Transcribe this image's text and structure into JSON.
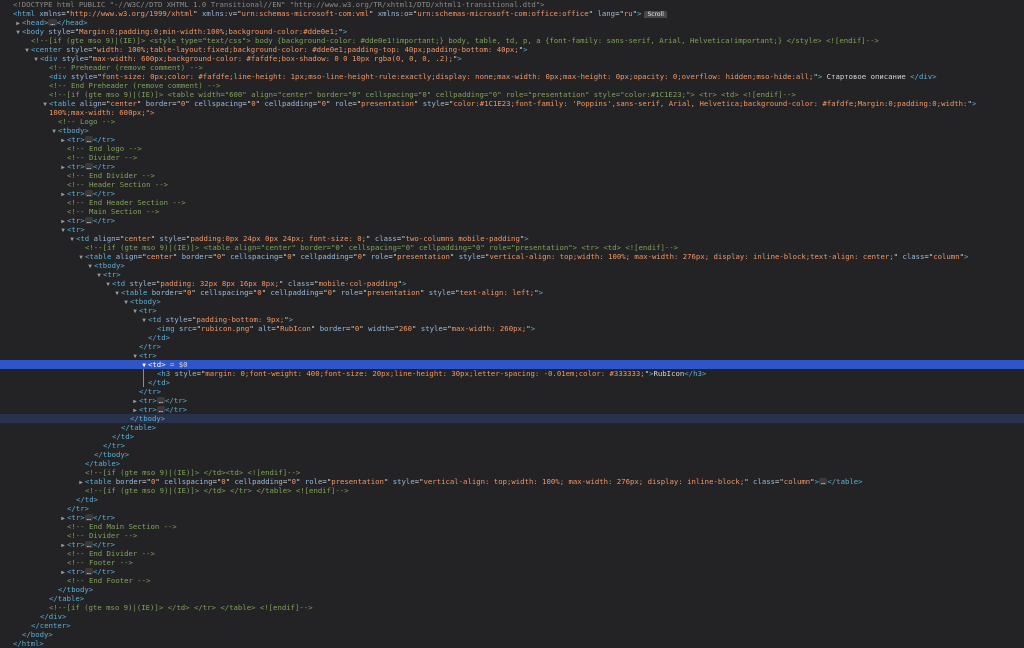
{
  "app": {
    "scroll_badge": "Scroll",
    "selected_suffix": " = $0",
    "ellipsis": "…"
  },
  "rows": [
    {
      "i": 0,
      "k": "doctype",
      "text": "<!DOCTYPE html PUBLIC \"-//W3C//DTD XHTML 1.0 Transitional//EN\" \"http://www.w3.org/TR/xhtml1/DTD/xhtml1-transitional.dtd\">"
    },
    {
      "i": 0,
      "k": "tag",
      "t": "",
      "tag": "html",
      "attrs": [
        [
          "xmlns",
          "http://www.w3.org/1999/xhtml"
        ],
        [
          "xmlns:v",
          "urn:schemas-microsoft-com:vml"
        ],
        [
          "xmlns:o",
          "urn:schemas-microsoft-com:office:office"
        ],
        [
          "lang",
          "ru"
        ]
      ],
      "badge": true
    },
    {
      "i": 1,
      "k": "tag",
      "t": "▶",
      "tag": "head",
      "collapsed": true
    },
    {
      "i": 1,
      "k": "tag",
      "t": "▼",
      "tag": "body",
      "attrs": [
        [
          "style",
          "Margin:0;padding:0;min-width:100%;background-color:#dde0e1;"
        ]
      ]
    },
    {
      "i": 2,
      "k": "comment",
      "text": "<!--[if (gte mso 9)|(IE)]> <style type=\"text/css\"> body {background-color: #dde0e1!important;} body, table, td, p, a {font-family: sans-serif, Arial, Helvetica!important;} </style> <![endif]-->"
    },
    {
      "i": 2,
      "k": "tag",
      "t": "▼",
      "tag": "center",
      "attrs": [
        [
          "style",
          "width: 100%;table-layout:fixed;background-color: #dde0e1;padding-top: 40px;padding-bottom: 40px;"
        ]
      ]
    },
    {
      "i": 3,
      "k": "tag",
      "t": "▼",
      "tag": "div",
      "attrs": [
        [
          "style",
          "max-width: 600px;background-color: #fafdfe;box-shadow: 0 0 10px rgba(0, 0, 0, .2);"
        ]
      ]
    },
    {
      "i": 4,
      "k": "comment",
      "text": "<!-- Preheader (remove comment) -->"
    },
    {
      "i": 4,
      "k": "tagtext",
      "t": "",
      "tag": "div",
      "attrs": [
        [
          "style",
          "font-size: 0px;color: #fafdfe;line-height: 1px;mso-line-height-rule:exactly;display: none;max-width: 0px;max-height: 0px;opacity: 0;overflow: hidden;mso-hide:all;"
        ]
      ],
      "inner": " Стартовое описание "
    },
    {
      "i": 4,
      "k": "comment",
      "text": "<!-- End Preheader (remove comment) -->"
    },
    {
      "i": 4,
      "k": "comment",
      "text": "<!--[if (gte mso 9)|(IE)]> <table width=\"600\" align=\"center\" border=\"0\" cellspacing=\"0\" cellpadding=\"0\" role=\"presentation\" style=\"color:#1C1E23;\"> <tr> <td> <![endif]-->"
    },
    {
      "i": 4,
      "k": "tag",
      "t": "▼",
      "tag": "table",
      "attrs": [
        [
          "align",
          "center"
        ],
        [
          "border",
          "0"
        ],
        [
          "cellspacing",
          "0"
        ],
        [
          "cellpadding",
          "0"
        ],
        [
          "role",
          "presentation"
        ],
        [
          "style",
          "color:#1C1E23;font-family: 'Poppins',sans-serif, Arial, Helvetica;background-color: #fafdfe;Margin:0;padding:0;width:"
        ]
      ]
    },
    {
      "i": 4,
      "k": "cont",
      "text": "100%;max-width: 600px;\">"
    },
    {
      "i": 5,
      "k": "comment",
      "text": "<!-- Logo -->"
    },
    {
      "i": 5,
      "k": "tag",
      "t": "▼",
      "tag": "tbody"
    },
    {
      "i": 6,
      "k": "tag",
      "t": "▶",
      "tag": "tr",
      "collapsed": true
    },
    {
      "i": 6,
      "k": "comment",
      "text": "<!-- End logo -->"
    },
    {
      "i": 6,
      "k": "comment",
      "text": "<!-- Divider -->"
    },
    {
      "i": 6,
      "k": "tag",
      "t": "▶",
      "tag": "tr",
      "collapsed": true
    },
    {
      "i": 6,
      "k": "comment",
      "text": "<!-- End Divider -->"
    },
    {
      "i": 6,
      "k": "comment",
      "text": "<!-- Header Section -->"
    },
    {
      "i": 6,
      "k": "tag",
      "t": "▶",
      "tag": "tr",
      "collapsed": true
    },
    {
      "i": 6,
      "k": "comment",
      "text": "<!-- End Header Section -->"
    },
    {
      "i": 6,
      "k": "comment",
      "text": "<!-- Main Section -->"
    },
    {
      "i": 6,
      "k": "tag",
      "t": "▶",
      "tag": "tr",
      "collapsed": true
    },
    {
      "i": 6,
      "k": "tag",
      "t": "▼",
      "tag": "tr"
    },
    {
      "i": 7,
      "k": "tag",
      "t": "▼",
      "tag": "td",
      "attrs": [
        [
          "align",
          "center"
        ],
        [
          "style",
          "padding:0px 24px 0px 24px; font-size: 0;"
        ],
        [
          "class",
          "two-columns mobile-padding"
        ]
      ]
    },
    {
      "i": 8,
      "k": "comment",
      "text": "<!--[if (gte mso 9)|(IE)]> <table align=\"center\" border=\"0\" cellspacing=\"0\" cellpadding=\"0\" role=\"presentation\"> <tr> <td> <![endif]-->"
    },
    {
      "i": 8,
      "k": "tag",
      "t": "▼",
      "tag": "table",
      "attrs": [
        [
          "align",
          "center"
        ],
        [
          "border",
          "0"
        ],
        [
          "cellspacing",
          "0"
        ],
        [
          "cellpadding",
          "0"
        ],
        [
          "role",
          "presentation"
        ],
        [
          "style",
          "vertical-align: top;width: 100%; max-width: 276px; display: inline-block;text-align: center;"
        ],
        [
          "class",
          "column"
        ]
      ]
    },
    {
      "i": 9,
      "k": "tag",
      "t": "▼",
      "tag": "tbody"
    },
    {
      "i": 10,
      "k": "tag",
      "t": "▼",
      "tag": "tr"
    },
    {
      "i": 11,
      "k": "tag",
      "t": "▼",
      "tag": "td",
      "attrs": [
        [
          "style",
          "padding: 32px 8px 16px 8px;"
        ],
        [
          "class",
          "mobile-col-padding"
        ]
      ]
    },
    {
      "i": 12,
      "k": "tag",
      "t": "▼",
      "tag": "table",
      "attrs": [
        [
          "border",
          "0"
        ],
        [
          "cellspacing",
          "0"
        ],
        [
          "cellpadding",
          "0"
        ],
        [
          "role",
          "presentation"
        ],
        [
          "style",
          "text-align: left;"
        ]
      ]
    },
    {
      "i": 13,
      "k": "tag",
      "t": "▼",
      "tag": "tbody"
    },
    {
      "i": 14,
      "k": "tag",
      "t": "▼",
      "tag": "tr"
    },
    {
      "i": 15,
      "k": "tag",
      "t": "▼",
      "tag": "td",
      "attrs": [
        [
          "style",
          "padding-bottom: 9px;"
        ]
      ]
    },
    {
      "i": 16,
      "k": "tag",
      "t": "",
      "tag": "img",
      "attrs": [
        [
          "src",
          "rubicon.png"
        ],
        [
          "alt",
          "RubIcon"
        ],
        [
          "border",
          "0"
        ],
        [
          "width",
          "260"
        ],
        [
          "style",
          "max-width: 260px;"
        ]
      ],
      "selfclose": true
    },
    {
      "i": 15,
      "k": "close",
      "tag": "td"
    },
    {
      "i": 14,
      "k": "close",
      "tag": "tr"
    },
    {
      "i": 14,
      "k": "tag",
      "t": "▼",
      "tag": "tr"
    },
    {
      "i": 15,
      "k": "tag",
      "t": "▼",
      "tag": "td",
      "sel": true
    },
    {
      "i": 16,
      "k": "tagtext",
      "t": "",
      "tag": "h3",
      "attrs": [
        [
          "style",
          "margin: 0;font-weight: 400;font-size: 20px;line-height: 30px;letter-spacing: -0.01em;color: #333333;"
        ]
      ],
      "inner": "RubIcon"
    },
    {
      "i": 15,
      "k": "close",
      "tag": "td"
    },
    {
      "i": 14,
      "k": "close",
      "tag": "tr"
    },
    {
      "i": 14,
      "k": "tag",
      "t": "▶",
      "tag": "tr",
      "collapsed": true
    },
    {
      "i": 14,
      "k": "tag",
      "t": "▶",
      "tag": "tr",
      "collapsed": true
    },
    {
      "i": 13,
      "k": "close",
      "tag": "tbody",
      "band": true
    },
    {
      "i": 12,
      "k": "close",
      "tag": "table"
    },
    {
      "i": 11,
      "k": "close",
      "tag": "td"
    },
    {
      "i": 10,
      "k": "close",
      "tag": "tr"
    },
    {
      "i": 9,
      "k": "close",
      "tag": "tbody"
    },
    {
      "i": 8,
      "k": "close",
      "tag": "table"
    },
    {
      "i": 8,
      "k": "comment",
      "text": "<!--[if (gte mso 9)|(IE)]> </td><td> <![endif]-->"
    },
    {
      "i": 8,
      "k": "tag",
      "t": "▶",
      "tag": "table",
      "attrs": [
        [
          "border",
          "0"
        ],
        [
          "cellspacing",
          "0"
        ],
        [
          "cellpadding",
          "0"
        ],
        [
          "role",
          "presentation"
        ],
        [
          "style",
          "vertical-align: top;width: 100%; max-width: 276px; display: inline-block;"
        ],
        [
          "class",
          "column"
        ]
      ],
      "collapsed": true
    },
    {
      "i": 8,
      "k": "comment",
      "text": "<!--[if (gte mso 9)|(IE)]> </td> </tr> </table> <![endif]-->"
    },
    {
      "i": 7,
      "k": "close",
      "tag": "td"
    },
    {
      "i": 6,
      "k": "close",
      "tag": "tr"
    },
    {
      "i": 6,
      "k": "tag",
      "t": "▶",
      "tag": "tr",
      "collapsed": true
    },
    {
      "i": 6,
      "k": "comment",
      "text": "<!-- End Main Section -->"
    },
    {
      "i": 6,
      "k": "comment",
      "text": "<!-- Divider -->"
    },
    {
      "i": 6,
      "k": "tag",
      "t": "▶",
      "tag": "tr",
      "collapsed": true
    },
    {
      "i": 6,
      "k": "comment",
      "text": "<!-- End Divider -->"
    },
    {
      "i": 6,
      "k": "comment",
      "text": "<!-- Footer -->"
    },
    {
      "i": 6,
      "k": "tag",
      "t": "▶",
      "tag": "tr",
      "collapsed": true
    },
    {
      "i": 6,
      "k": "comment",
      "text": "<!-- End Footer -->"
    },
    {
      "i": 5,
      "k": "close",
      "tag": "tbody"
    },
    {
      "i": 4,
      "k": "close",
      "tag": "table"
    },
    {
      "i": 4,
      "k": "comment",
      "text": "<!--[if (gte mso 9)|(IE)]> </td> </tr> </table> <![endif]-->"
    },
    {
      "i": 3,
      "k": "close",
      "tag": "div"
    },
    {
      "i": 2,
      "k": "close",
      "tag": "center"
    },
    {
      "i": 1,
      "k": "close",
      "tag": "body"
    },
    {
      "i": 0,
      "k": "close",
      "tag": "html"
    }
  ]
}
